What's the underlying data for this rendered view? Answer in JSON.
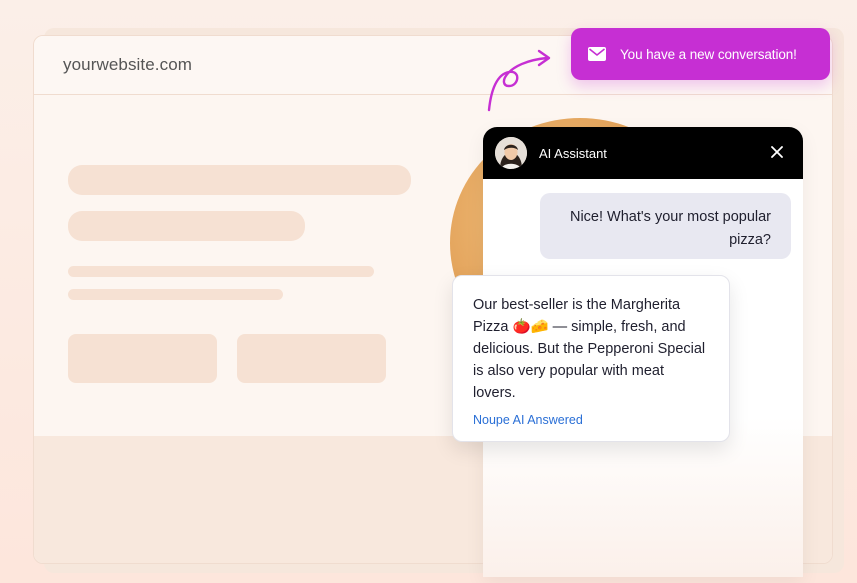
{
  "browser": {
    "url": "yourwebsite.com"
  },
  "notification": {
    "icon": "mail-icon",
    "text": "You have a new conversation!",
    "color": "#c62fd3"
  },
  "chat": {
    "title": "AI Assistant",
    "close_icon": "close-icon",
    "messages": [
      {
        "role": "user",
        "text": "Nice! What's your most popular pizza?"
      },
      {
        "role": "assistant",
        "text": "Our best-seller is the Margherita Pizza 🍅🧀 — simple, fresh, and delicious. But the Pepperoni Special is also very popular with meat lovers.",
        "meta": "Noupe AI Answered"
      }
    ]
  }
}
